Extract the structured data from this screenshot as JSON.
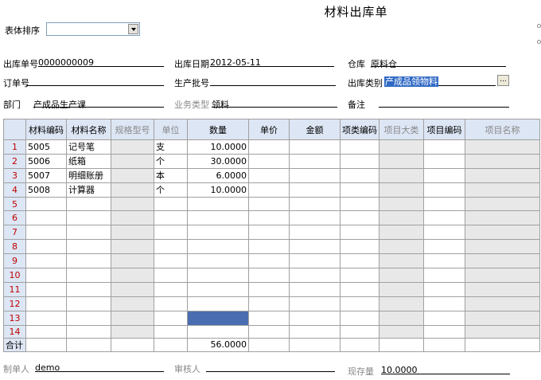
{
  "form": {
    "title": "材料出库单",
    "sort_label": "表体排序",
    "sort_value": ""
  },
  "header": {
    "doc_no_label": "出库单号",
    "doc_no": "0000000009",
    "date_label": "出库日期",
    "date": "2012-05-11",
    "warehouse_label": "仓库",
    "warehouse": "原料仓",
    "order_no_label": "订单号",
    "order_no": "",
    "batch_label": "生产批号",
    "batch": "",
    "type_label": "出库类别",
    "type": "产成品领物料",
    "type_button": "...",
    "dept_label": "部门",
    "dept": "产成品生产课",
    "biz_type_label": "业务类型",
    "biz_type": "领料",
    "remark_label": "备注",
    "remark": ""
  },
  "table": {
    "columns": [
      "材料编码",
      "材料名称",
      "规格型号",
      "单位",
      "数量",
      "单价",
      "金额",
      "项类编码",
      "项目大类",
      "项目编码",
      "项目名称"
    ],
    "rows": [
      {
        "no": "1",
        "code": "5005",
        "name": "记号笔",
        "unit": "支",
        "qty": "10.0000"
      },
      {
        "no": "2",
        "code": "5006",
        "name": "纸箱",
        "unit": "个",
        "qty": "30.0000"
      },
      {
        "no": "3",
        "code": "5007",
        "name": "明细账册",
        "unit": "本",
        "qty": "6.0000"
      },
      {
        "no": "4",
        "code": "5008",
        "name": "计算器",
        "unit": "个",
        "qty": "10.0000"
      },
      {
        "no": "5"
      },
      {
        "no": "6"
      },
      {
        "no": "7"
      },
      {
        "no": "8"
      },
      {
        "no": "9"
      },
      {
        "no": "10"
      },
      {
        "no": "11"
      },
      {
        "no": "12"
      },
      {
        "no": "13"
      },
      {
        "no": "14"
      }
    ],
    "total_label": "合计",
    "total_qty": "56.0000"
  },
  "footer": {
    "maker_label": "制单人",
    "maker": "demo",
    "auditor_label": "审核人",
    "auditor": "",
    "stock_label": "现存量",
    "stock": "10.0000"
  }
}
